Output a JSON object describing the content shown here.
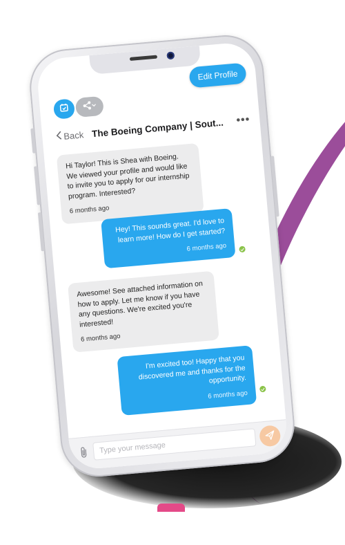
{
  "header": {
    "edit_profile_label": "Edit Profile",
    "back_label": "Back",
    "conversation_title": "The Boeing Company | Sout...",
    "more_label": "•••"
  },
  "messages": [
    {
      "direction": "incoming",
      "text": "Hi Taylor! This is Shea with Boeing. We viewed your profile and would like to invite you to apply for our internship program. Interested?",
      "time": "6 months ago"
    },
    {
      "direction": "outgoing",
      "text": "Hey! This sounds great. I'd love to learn more! How do I get started?",
      "time": "6 months ago",
      "read": true
    },
    {
      "direction": "incoming",
      "text": "Awesome! See attached information on how to apply. Let me know if you have any questions. We're excited you're interested!",
      "time": "6 months ago"
    },
    {
      "direction": "outgoing",
      "text": "I'm excited too! Happy that you discovered me and thanks for the opportunity.",
      "time": "6 months ago",
      "read": true
    }
  ],
  "composer": {
    "placeholder": "Type your message"
  },
  "icons": {
    "calendar": "calendar-icon",
    "share": "share-icon",
    "attach": "paperclip-icon",
    "send": "send-icon",
    "back": "chevron-left-icon"
  },
  "colors": {
    "accent": "#29a7ee",
    "incoming_bubble": "#ececed",
    "read_check": "#8bc34a",
    "send_button": "#f7c9a3",
    "decor_purple": "#9b4d9a"
  }
}
